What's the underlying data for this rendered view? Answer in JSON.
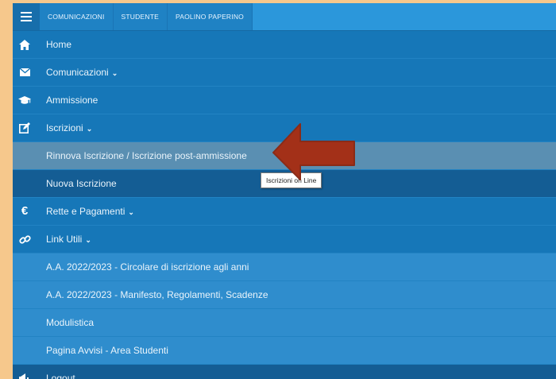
{
  "top_tabs": [
    "COMUNICAZIONI",
    "STUDENTE",
    "PAOLINO PAPERINO"
  ],
  "menu": {
    "home": "Home",
    "comunicazioni": "Comunicazioni",
    "ammissione": "Ammissione",
    "iscrizioni": "Iscrizioni",
    "rinnova": "Rinnova Iscrizione / Iscrizione post-ammissione",
    "nuova": "Nuova Iscrizione",
    "rette": "Rette e Pagamenti",
    "link_utili": "Link Utili",
    "circolare": "A.A. 2022/2023 - Circolare di iscrizione agli anni",
    "manifesto": "A.A. 2022/2023 - Manifesto, Regolamenti, Scadenze",
    "modulistica": "Modulistica",
    "avvisi": "Pagina Avvisi - Area Studenti",
    "logout": "Logout"
  },
  "tooltip": "Iscrizioni on Line",
  "colors": {
    "background": "#f6c88c",
    "menu": "#1677b8",
    "topbar": "#2b97db",
    "arrow": "#a33018"
  },
  "icons": {
    "menu": "hamburger-icon",
    "home": "home-icon",
    "comunicazioni": "envelope-icon",
    "ammissione": "graduation-cap-icon",
    "iscrizioni": "edit-icon",
    "rette": "euro-icon",
    "link_utili": "link-icon",
    "logout": "megaphone-icon"
  }
}
